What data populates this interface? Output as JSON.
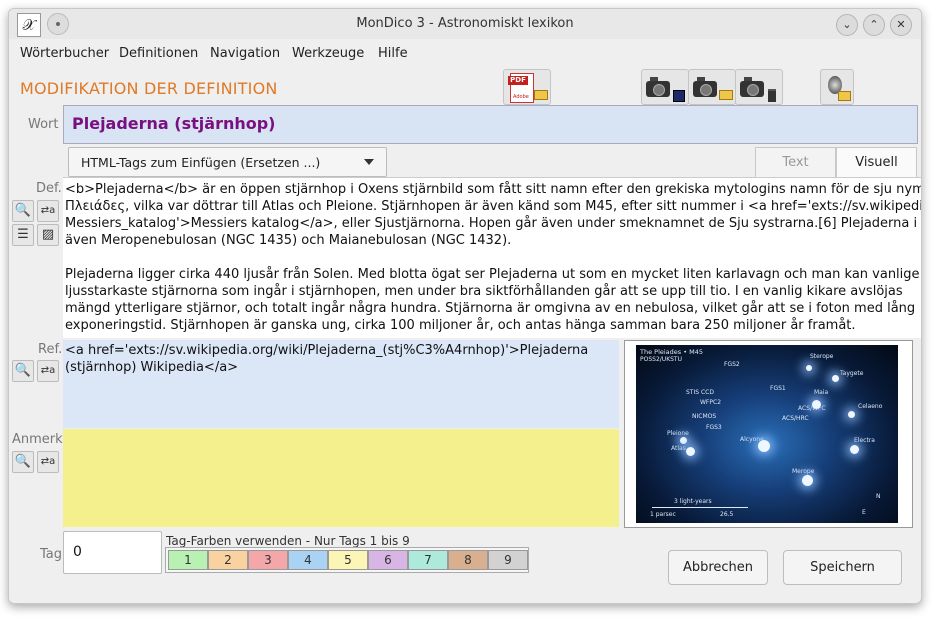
{
  "window": {
    "title": "MonDico 3 - Astronomiskt lexikon",
    "app_icon_glyph": "𝒳"
  },
  "menu": [
    "Wörterbucher",
    "Definitionen",
    "Navigation",
    "Werkzeuge",
    "Hilfe"
  ],
  "heading": "MODIFIKATION DER DEFINITION",
  "toolbar": {
    "pdf_label": "PDF",
    "pdf_sub": "Adobe",
    "icons": [
      "pdf-open-icon",
      "camera-save-icon",
      "camera-open-icon",
      "camera-delete-icon",
      "speaker-open-icon"
    ]
  },
  "labels": {
    "word": "Wort",
    "def": "Def.",
    "ref": "Ref.",
    "note": "Anmerku",
    "tag": "Tag"
  },
  "word": "Plejaderna (stjärnhop)",
  "html_tags": {
    "combo": "HTML-Tags zum Einfügen (Ersetzen ...)",
    "tab_text": "Text",
    "tab_visual": "Visuell"
  },
  "definition": "<b>Plejaderna</b> är en öppen stjärnhop i Oxens stjärnbild som fått sitt namn efter den grekiska mytologins namn för de sju nymfe\nΠλειάδες, vilka var döttrar till Atlas och Pleione. Stjärnhopen är även känd som M45, efter sitt nummer i <a href='exts://sv.wikipedi\nMessiers_katalog'>Messiers katalog</a>, eller Sjustjärnorna. Hopen går även under smeknamnet de Sju systrarna.[6] Plejaderna i\näven Meropenebulosan (NGC 1435) och Maianebulosan (NGC 1432).\n\nPlejaderna ligger cirka 440 ljusår från Solen. Med blotta ögat ser Plejaderna ut som en mycket liten karlavagn och man kan vanlige\nljusstarkaste stjärnorna som ingår i stjärnhopen, men under bra siktförhållanden går att se upp till tio. I en vanlig kikare avslöjas\nmängd ytterligare stjärnor, och totalt ingår några hundra. Stjärnorna är omgivna av en nebulosa, vilket går att se i foton med lång\nexponeringstid. Stjärnhopen är ganska ung, cirka 100 miljoner år, och antas hänga samman bara 250 miljoner år framåt.",
  "reference": "<a href='exts://sv.wikipedia.org/wiki/Plejaderna_(stj%C3%A4rnhop)'>Plejaderna (stjärnhop) Wikipedia</a>",
  "image_labels": {
    "title": "The Pleiades • M45",
    "survey": "POSS2/UKSTU",
    "fgs2": "FGS2",
    "fgs1": "FGS1",
    "sterope": "Sterope",
    "taygete": "Taygete",
    "maia": "Maia",
    "celaeno": "Celaeno",
    "stis": "STIS CCD",
    "wfpc2": "WFPC2",
    "acswfc": "ACS/WFC",
    "acshrc": "ACS/HRC",
    "nicmos": "NICMOS",
    "fgs3": "FGS3",
    "pleione": "Pleione",
    "atlas": "Atlas",
    "alcyone": "Alcyone",
    "electra": "Electra",
    "merope": "Merope",
    "scale": "3 light-years",
    "parsec": "1 parsec",
    "scale_right": "26.5",
    "north": "N",
    "east": "E"
  },
  "tag": {
    "value": "0",
    "colors_label": "Tag-Farben verwenden - Nur Tags 1 bis 9",
    "chips": [
      {
        "label": "1",
        "color": "#b9f0b3"
      },
      {
        "label": "2",
        "color": "#f9d2a0"
      },
      {
        "label": "3",
        "color": "#f3a7a9"
      },
      {
        "label": "4",
        "color": "#a9d2f4"
      },
      {
        "label": "5",
        "color": "#fbf6b6"
      },
      {
        "label": "6",
        "color": "#d7b6e6"
      },
      {
        "label": "7",
        "color": "#aeeadc"
      },
      {
        "label": "8",
        "color": "#d9b08f"
      },
      {
        "label": "9",
        "color": "#d2d2d2"
      }
    ]
  },
  "buttons": {
    "cancel": "Abbrechen",
    "save": "Speichern"
  }
}
